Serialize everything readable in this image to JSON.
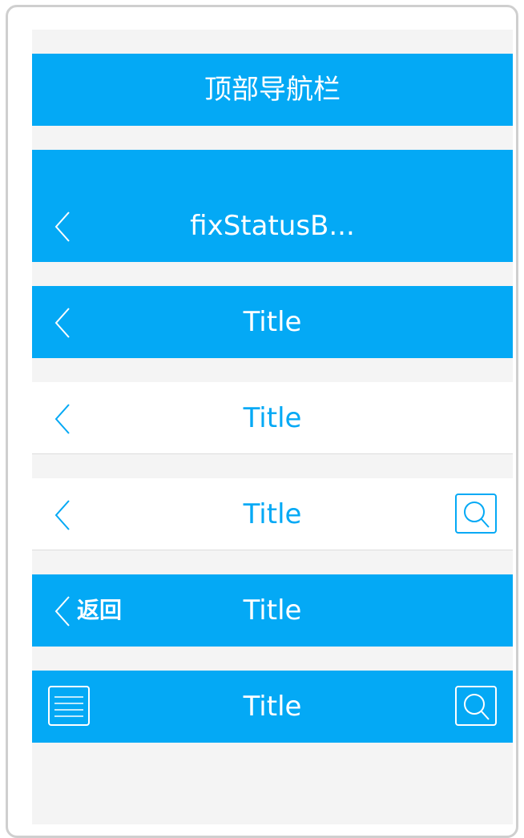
{
  "colors": {
    "accent": "#04a9f5",
    "page_bg": "#f4f4f4",
    "bar_white": "#ffffff"
  },
  "navbars": [
    {
      "style": "blue",
      "title": "顶部导航栏"
    },
    {
      "style": "blue",
      "title": "fixStatusB...",
      "left_icon": "chevron-left-icon"
    },
    {
      "style": "blue",
      "title": "Title",
      "left_icon": "chevron-left-icon"
    },
    {
      "style": "white",
      "title": "Title",
      "left_icon": "chevron-left-icon"
    },
    {
      "style": "white",
      "title": "Title",
      "left_icon": "chevron-left-icon",
      "right_icon": "search-icon"
    },
    {
      "style": "blue",
      "title": "Title",
      "left_icon": "chevron-left-icon",
      "back_label": "返回"
    },
    {
      "style": "blue",
      "title": "Title",
      "left_icon": "menu-icon",
      "right_icon": "search-icon"
    }
  ]
}
